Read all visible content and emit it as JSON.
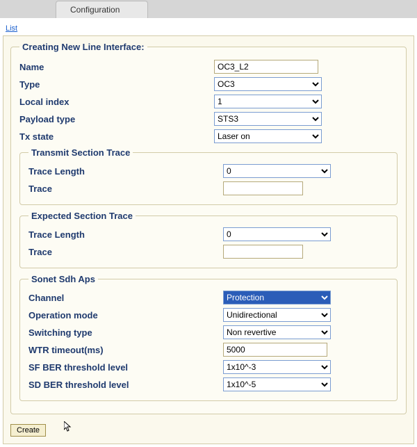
{
  "header": {
    "tab": "Configuration"
  },
  "linkbar": {
    "list": "List"
  },
  "form": {
    "legend": "Creating New Line Interface:",
    "name_label": "Name",
    "name_value": "OC3_L2",
    "type_label": "Type",
    "type_value": "OC3",
    "local_index_label": "Local index",
    "local_index_value": "1",
    "payload_type_label": "Payload type",
    "payload_type_value": "STS3",
    "tx_state_label": "Tx state",
    "tx_state_value": "Laser on"
  },
  "txSection": {
    "legend": "Transmit Section Trace",
    "trace_length_label": "Trace Length",
    "trace_length_value": "0",
    "trace_label": "Trace",
    "trace_value": ""
  },
  "expSection": {
    "legend": "Expected Section Trace",
    "trace_length_label": "Trace Length",
    "trace_length_value": "0",
    "trace_label": "Trace",
    "trace_value": ""
  },
  "aps": {
    "legend": "Sonet Sdh Aps",
    "channel_label": "Channel",
    "channel_value": "Protection",
    "op_mode_label": "Operation mode",
    "op_mode_value": "Unidirectional",
    "switching_type_label": "Switching type",
    "switching_type_value": "Non revertive",
    "wtr_label": "WTR timeout(ms)",
    "wtr_value": "5000",
    "sf_label": "SF BER threshold level",
    "sf_value": "1x10^-3",
    "sd_label": "SD BER threshold level",
    "sd_value": "1x10^-5"
  },
  "buttons": {
    "create": "Create"
  }
}
